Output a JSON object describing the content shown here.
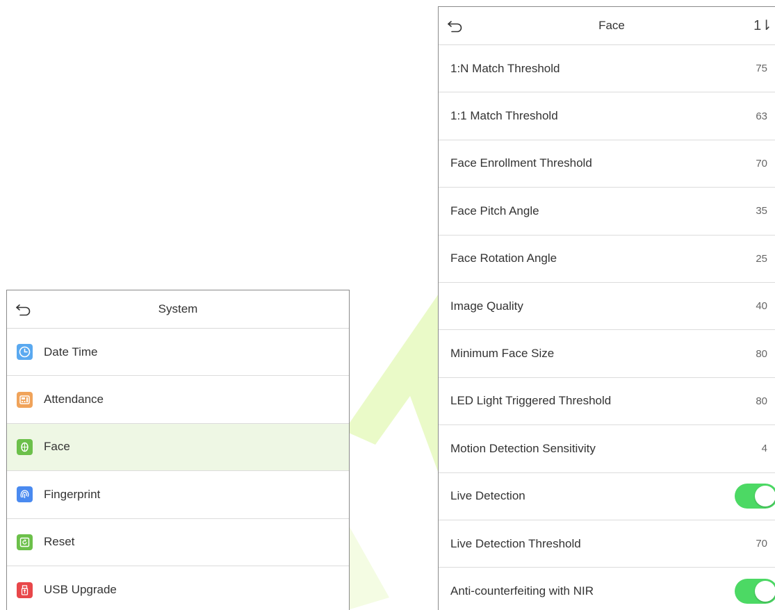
{
  "colors": {
    "selected_row": "#eef7e4",
    "toggle_on": "#4cd964",
    "watermark": "#d8f59a"
  },
  "system_screen": {
    "title": "System",
    "back_icon": "back-arrow-icon",
    "items": [
      {
        "label": "Date Time",
        "icon": "clock-icon",
        "icon_color": "#5aa9f0",
        "selected": false
      },
      {
        "label": "Attendance",
        "icon": "attendance-icon",
        "icon_color": "#f0a35a",
        "selected": false
      },
      {
        "label": "Face",
        "icon": "face-icon",
        "icon_color": "#6cc04a",
        "selected": true
      },
      {
        "label": "Fingerprint",
        "icon": "fingerprint-icon",
        "icon_color": "#4a8af0",
        "selected": false
      },
      {
        "label": "Reset",
        "icon": "reset-icon",
        "icon_color": "#6cc04a",
        "selected": false
      },
      {
        "label": "USB Upgrade",
        "icon": "usb-icon",
        "icon_color": "#e8474a",
        "selected": false
      }
    ]
  },
  "face_screen": {
    "title": "Face",
    "back_icon": "back-arrow-icon",
    "sort_icon": "sort-arrows-icon",
    "sort_glyph": "1⇂",
    "settings": [
      {
        "label": "1:N Match Threshold",
        "value": "75"
      },
      {
        "label": "1:1 Match Threshold",
        "value": "63"
      },
      {
        "label": "Face Enrollment Threshold",
        "value": "70"
      },
      {
        "label": "Face Pitch Angle",
        "value": "35"
      },
      {
        "label": "Face Rotation Angle",
        "value": "25"
      },
      {
        "label": "Image Quality",
        "value": "40"
      },
      {
        "label": "Minimum Face Size",
        "value": "80"
      },
      {
        "label": "LED Light Triggered Threshold",
        "value": "80"
      },
      {
        "label": "Motion Detection Sensitivity",
        "value": "4"
      },
      {
        "label": "Live Detection",
        "toggle": true
      },
      {
        "label": "Live Detection Threshold",
        "value": "70"
      },
      {
        "label": "Anti-counterfeiting with NIR",
        "toggle": true
      }
    ]
  }
}
